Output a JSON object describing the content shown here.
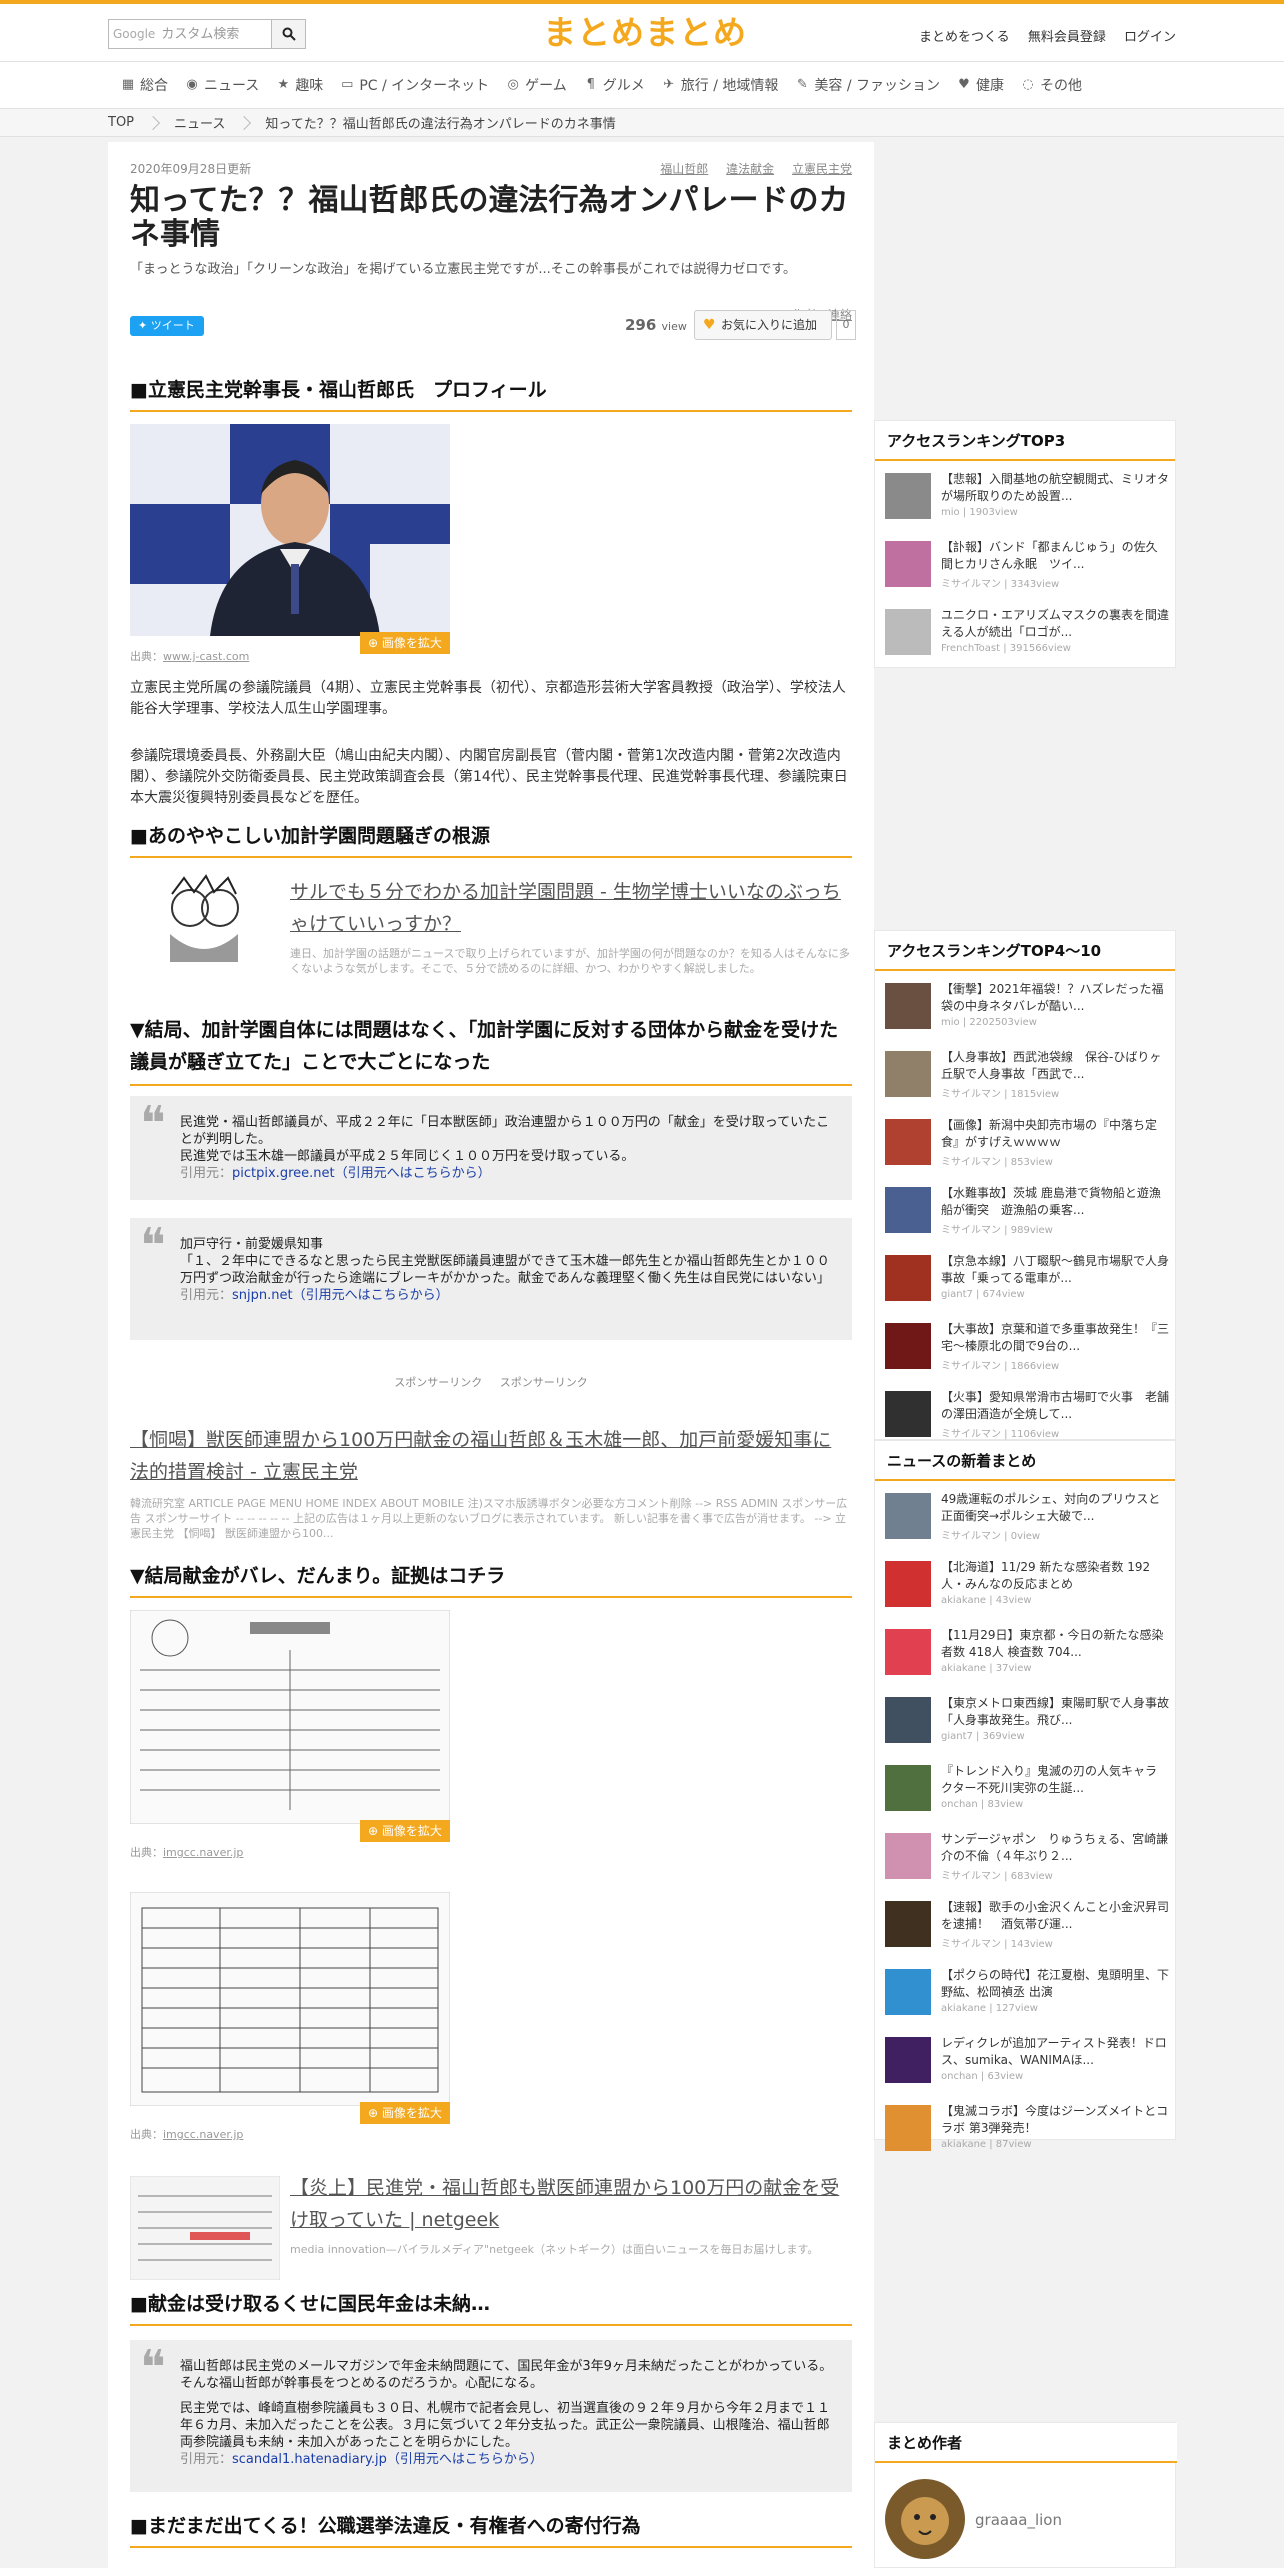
{
  "header": {
    "search_brand": "Google",
    "search_placeholder": "カスタム検索",
    "logo_text": "まとめまとめ",
    "links": [
      "まとめをつくる",
      "無料会員登録",
      "ログイン"
    ]
  },
  "nav": [
    {
      "icon": "grid-icon",
      "glyph": "▦",
      "label": "総合"
    },
    {
      "icon": "camera-icon",
      "glyph": "◉",
      "label": "ニュース"
    },
    {
      "icon": "star-icon",
      "glyph": "★",
      "label": "趣味"
    },
    {
      "icon": "monitor-icon",
      "glyph": "▭",
      "label": "PC / インターネット"
    },
    {
      "icon": "gamepad-icon",
      "glyph": "◎",
      "label": "ゲーム"
    },
    {
      "icon": "fork-icon",
      "glyph": "¶",
      "label": "グルメ"
    },
    {
      "icon": "plane-icon",
      "glyph": "✈",
      "label": "旅行 / 地域情報"
    },
    {
      "icon": "brush-icon",
      "glyph": "✎",
      "label": "美容 / ファッション"
    },
    {
      "icon": "heart-icon",
      "glyph": "♥",
      "label": "健康"
    },
    {
      "icon": "other-icon",
      "glyph": "◌",
      "label": "その他"
    }
  ],
  "breadcrumb": [
    "TOP",
    "ニュース",
    "知ってた？？福山哲郎氏の違法行為オンパレードのカネ事情"
  ],
  "article": {
    "date": "2020年09月28日更新",
    "tags": [
      "福山哲郎",
      "違法献金",
      "立憲民主党"
    ],
    "title": "知ってた？？福山哲郎氏の違法行為オンパレードのカネ事情",
    "description": "「まっとうな政治」「クリーンな政治」を掲げている立憲民主党ですが...そこの幹事長がこれでは説得力ゼロです。",
    "author_link": "作者へ連絡",
    "tweet_label": "ツイート",
    "view_count": "296",
    "view_unit": "view",
    "fav_label": "お気に入りに追加",
    "fav_count": "0",
    "source_prefix": "出典：",
    "expand_label": "画像を拡大",
    "quote_cite_prefix": "引用元：",
    "sponsor_text": "スポンサーリンク スポンサーリンク",
    "sections": {
      "h_profile": "■立憲民主党幹事長・福山哲郎氏　プロフィール",
      "img1_src": "www.j-cast.com",
      "p1": "立憲民主党所属の参議院議員（4期）、立憲民主党幹事長（初代）、京都造形芸術大学客員教授（政治学）、学校法人能谷大学理事、学校法人瓜生山学園理事。",
      "p2": "参議院環境委員長、外務副大臣（鳩山由紀夫内閣）、内閣官房副長官（菅内閣・菅第1次改造内閣・菅第2次改造内閣）、参議院外交防衛委員長、民主党政策調査会長（第14代）、民主党幹事長代理、民進党幹事長代理、参議院東日本大震災復興特別委員長などを歴任。",
      "h_kake": "■あのややこしい加計学園問題騒ぎの根源",
      "link1_title": "サルでも５分でわかる加計学園問題 - 生物学博士いいなのぶっちゃけていいっすか？",
      "link1_desc": "連日、加計学園の話題がニュースで取り上げられていますが、加計学園の何が問題なのか？を知る人はそんなに多くないような気がします。そこで、５分で読めるのに詳細、かつ、わかりやすく解説しました。",
      "h_kekkyoku": "▼結局、加計学園自体には問題はなく、「加計学園に反対する団体から献金を受けた議員が騒ぎ立てた」ことで大ごとになった",
      "q1_line1": "民進党・福山哲郎議員が、平成２２年に「日本獣医師」政治連盟から１００万円の「献金」を受け取っていたことが判明した。",
      "q1_line2": "民進党では玉木雄一郎議員が平成２５年同じく１００万円を受け取っている。",
      "q1_cite": "pictpix.gree.net（引用元へはこちらから）",
      "q2_line1": "加戸守行・前愛媛県知事",
      "q2_line2": "「１、２年中にできるなと思ったら民主党獣医師議員連盟ができて玉木雄一郎先生とか福山哲郎先生とか１００万円ずつ政治献金が行ったら途端にブレーキがかかった。献金であんな義理堅く働く先生は自民党にはいない」",
      "q2_cite": "snjpn.net（引用元へはこちらから）",
      "link2_title": "【恫喝】獣医師連盟から100万円献金の福山哲郎＆玉木雄一郎、加戸前愛媛知事に法的措置検討 - 立憲民主党",
      "link2_desc": "韓流研究室 ARTICLE PAGE MENU HOME INDEX ABOUT MOBILE 注)スマホ版誘導ボタン必要な方コメント削除 --> RSS ADMIN スポンサー広告 スポンサーサイト -- -- -- -- -- 上記の広告は１ヶ月以上更新のないブログに表示されています。 新しい記事を書く事で広告が消せます。 --> 立憲民主党 【恫喝】 獣医師連盟から100...",
      "h_shouko": "▼結局献金がバレ、だんまり。証拠はコチラ",
      "img2_src": "imgcc.naver.jp",
      "img3_src": "imgcc.naver.jp",
      "link3_title": "【炎上】民進党・福山哲郎も獣医師連盟から100万円の献金を受け取っていた | netgeek",
      "link3_desc": "media innovation—バイラルメディア\"netgeek（ネットギーク）は面白いニュースを毎日お届けします。",
      "h_nenkin": "■献金は受け取るくせに国民年金は未納…",
      "q3_line1": "福山哲郎は民主党のメールマガジンで年金未納問題にて、国民年金が3年9ヶ月未納だったことがわかっている。そんな福山哲郎が幹事長をつとめるのだろうか。心配になる。",
      "q3_line2": "民主党では、峰崎直樹参院議員も３０日、札幌市で記者会見し、初当選直後の９２年９月から今年２月まで１１年６カ月、未加入だったことを公表。３月に気づいて２年分支払った。武正公一衆院議員、山根隆治、福山哲郎両参院議員も未納・未加入があったことを明らかにした。",
      "q3_cite": "scandal1.hatenadiary.jp（引用元へはこちらから）",
      "h_koushoku": "■まだまだ出てくる！公職選挙法違反・有権者への寄付行為"
    }
  },
  "sidebar": {
    "top3_title": "アクセスランキングTOP3",
    "top3": [
      {
        "title": "【悲報】入間基地の航空観閲式、ミリオタが場所取りのため設置...",
        "meta": "mio | 1903view"
      },
      {
        "title": "【訃報】バンド「都まんじゅう」の佐久間ヒカリさん永眠　ツイ...",
        "meta": "ミサイルマン | 3343view"
      },
      {
        "title": "ユニクロ・エアリズムマスクの裏表を間違える人が続出「ロゴが...",
        "meta": "FrenchToast | 391566view"
      }
    ],
    "top10_title": "アクセスランキングTOP4～10",
    "top10": [
      {
        "title": "【衝撃】2021年福袋！？ハズレだった福袋の中身ネタバレが酷い...",
        "meta": "mio | 2202503view"
      },
      {
        "title": "【人身事故】西武池袋線　保谷-ひばりヶ丘駅で人身事故「西武で...",
        "meta": "ミサイルマン | 1815view"
      },
      {
        "title": "【画像】新潟中央卸売市場の『中落ち定食』がすげえｗｗｗｗ",
        "meta": "ミサイルマン | 853view"
      },
      {
        "title": "【水難事故】茨城 鹿島港で貨物船と遊漁船が衝突　遊漁船の乗客...",
        "meta": "ミサイルマン | 989view"
      },
      {
        "title": "【京急本線】八丁畷駅〜鶴見市場駅で人身事故「乗ってる電車が...",
        "meta": "giant7 | 674view"
      },
      {
        "title": "【大事故】京葉和道で多重事故発生！『三宅〜榛原北の間で9台の...",
        "meta": "ミサイルマン | 1866view"
      },
      {
        "title": "【火事】愛知県常滑市古場町で火事　老舗の澤田酒造が全焼して...",
        "meta": "ミサイルマン | 1106view"
      }
    ],
    "news_title": "ニュースの新着まとめ",
    "news": [
      {
        "title": "49歳運転のポルシェ、対向のプリウスと正面衝突→ポルシェ大破で...",
        "meta": "ミサイルマン | 0view"
      },
      {
        "title": "【北海道】11/29 新たな感染者数 192人・みんなの反応まとめ",
        "meta": "akiakane | 43view"
      },
      {
        "title": "【11月29日】東京都・今日の新たな感染者数 418人 検査数 704...",
        "meta": "akiakane | 37view"
      },
      {
        "title": "【東京メトロ東西線】東陽町駅で人身事故「人身事故発生。飛び...",
        "meta": "giant7 | 369view"
      },
      {
        "title": "『トレンド入り』鬼滅の刃の人気キャラクター不死川実弥の生誕...",
        "meta": "onchan | 83view"
      },
      {
        "title": "サンデージャポン　りゅうちぇる、宮崎謙介の不倫（４年ぶり２...",
        "meta": "ミサイルマン | 683view"
      },
      {
        "title": "【速報】歌手の小金沢くんこと小金沢昇司を逮捕！　酒気帯び運...",
        "meta": "ミサイルマン | 143view"
      },
      {
        "title": "【ポクらの時代】花江夏樹、鬼頭明里、下野紘、松岡禎丞 出演",
        "meta": "akiakane | 127view"
      },
      {
        "title": "レディクレが追加アーティスト発表！ドロス、sumika、WANIMAほ...",
        "meta": "onchan | 63view"
      },
      {
        "title": "【鬼滅コラボ】今度はジーンズメイトとコラボ 第3弾発売！",
        "meta": "akiakane | 87view"
      }
    ],
    "author_title": "まとめ作者",
    "author_name": "graaaa_lion"
  },
  "colors": {
    "accent": "#f4a81d",
    "leaf": "#5aa12d",
    "tweet": "#1da1f2",
    "cite_link": "#1a3ea8"
  }
}
